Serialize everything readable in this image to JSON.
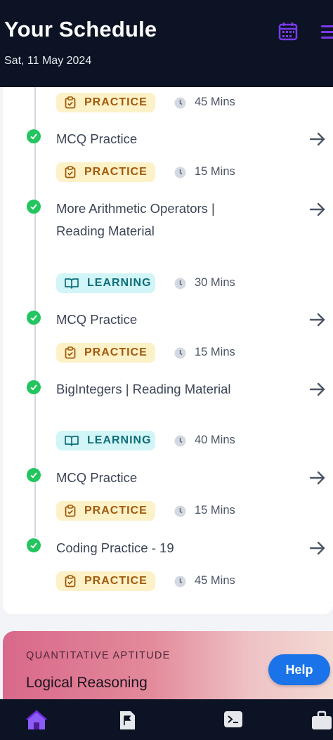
{
  "header": {
    "title": "Your Schedule",
    "date": "Sat, 11 May 2024"
  },
  "colors": {
    "accent": "#7c3aed",
    "success": "#22c55e",
    "header_bg": "#0b1324",
    "help": "#1a73e8"
  },
  "schedule": {
    "first_tags": {
      "badge": "PRACTICE",
      "type": "practice",
      "duration": "45 Mins"
    },
    "items": [
      {
        "title": "MCQ Practice",
        "badge": "PRACTICE",
        "type": "practice",
        "duration": "15 Mins"
      },
      {
        "title": "More Arithmetic Operators | Reading Material",
        "badge": "LEARNING",
        "type": "learning",
        "duration": "30 Mins"
      },
      {
        "title": "MCQ Practice",
        "badge": "PRACTICE",
        "type": "practice",
        "duration": "15 Mins"
      },
      {
        "title": "BigIntegers | Reading Material",
        "badge": "LEARNING",
        "type": "learning",
        "duration": "40 Mins"
      },
      {
        "title": "MCQ Practice",
        "badge": "PRACTICE",
        "type": "practice",
        "duration": "15 Mins"
      },
      {
        "title": "Coding Practice - 19",
        "badge": "PRACTICE",
        "type": "practice",
        "duration": "45 Mins"
      }
    ]
  },
  "aptitude_card": {
    "label": "QUANTITATIVE APTITUDE",
    "title": "Logical Reasoning"
  },
  "help": {
    "label": "Help"
  },
  "icons": [
    "calendar-icon",
    "menu-icon",
    "checklist-icon",
    "book-icon",
    "clock-icon",
    "arrow-right-icon",
    "check-circle-icon",
    "home-icon",
    "flag-icon",
    "terminal-icon",
    "briefcase-icon"
  ]
}
